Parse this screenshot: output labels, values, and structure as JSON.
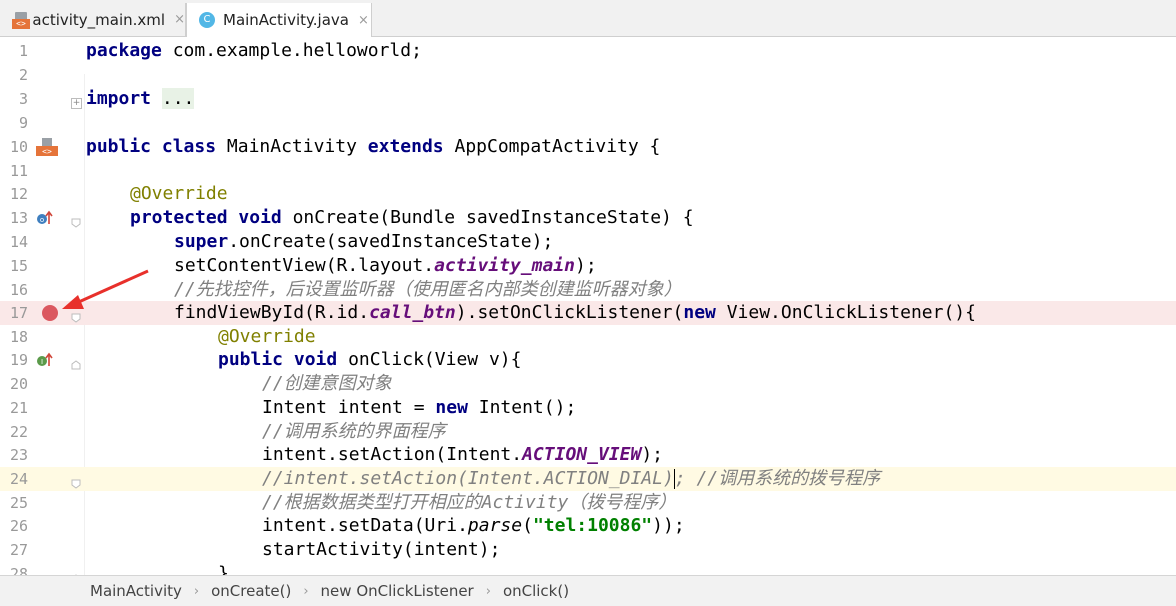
{
  "tabs": [
    {
      "label": "activity_main.xml",
      "icon": "xml-layout-icon",
      "close": "×",
      "active": false
    },
    {
      "label": "MainActivity.java",
      "icon": "java-class-icon",
      "icon_letter": "C",
      "close": "×",
      "active": true
    }
  ],
  "editor": {
    "lines": [
      {
        "n": "1"
      },
      {
        "n": "2"
      },
      {
        "n": "3"
      },
      {
        "n": "9"
      },
      {
        "n": "10"
      },
      {
        "n": "11"
      },
      {
        "n": "12"
      },
      {
        "n": "13"
      },
      {
        "n": "14"
      },
      {
        "n": "15"
      },
      {
        "n": "16"
      },
      {
        "n": "17"
      },
      {
        "n": "18"
      },
      {
        "n": "19"
      },
      {
        "n": "20"
      },
      {
        "n": "21"
      },
      {
        "n": "22"
      },
      {
        "n": "23"
      },
      {
        "n": "24"
      },
      {
        "n": "25"
      },
      {
        "n": "26"
      },
      {
        "n": "27"
      },
      {
        "n": "28"
      }
    ],
    "code": {
      "l1_kw": "package",
      "l1_rest": " com.example.helloworld;",
      "l3_kw": "import",
      "l3_collapsed": "...",
      "l9_kw1": "public",
      "l9_kw2": "class",
      "l9_name": " MainActivity ",
      "l9_kw3": "extends",
      "l9_rest": " AppCompatActivity {",
      "l12_ann": "@Override",
      "l13_kw1": "protected",
      "l13_kw2": "void",
      "l13_rest": " onCreate(Bundle savedInstanceState) {",
      "l14_kw": "super",
      "l14_rest": ".onCreate(savedInstanceState);",
      "l15_a": "setContentView(R.layout.",
      "l15_fld": "activity_main",
      "l15_b": ");",
      "l16_cmt": "//先找控件，后设置监听器（使用匿名内部类创建监听器对象）",
      "l17_a": "findViewById(R.id.",
      "l17_fld": "call_btn",
      "l17_b": ").setOnClickListener(",
      "l17_kw": "new",
      "l17_c": " View.OnClickListener(){",
      "l18_ann": "@Override",
      "l19_kw1": "public",
      "l19_kw2": "void",
      "l19_rest": " onClick(View v){",
      "l20_cmt": "//创建意图对象",
      "l21_a": "Intent intent = ",
      "l21_kw": "new",
      "l21_b": " Intent();",
      "l22_cmt": "//调用系统的界面程序",
      "l23_a": "intent.setAction(Intent.",
      "l23_fld": "ACTION_VIEW",
      "l23_b": ");",
      "l24_cmt1": "//intent.setAction(Intent.ACTION_DIAL)",
      "l24_cmt2": "; //调用系统的拨号程序",
      "l25_cmt": "//根据数据类型打开相应的Activity（拨号程序）",
      "l26_a": "intent.setData(Uri.",
      "l26_stat": "parse",
      "l26_b": "(",
      "l26_str": "\"tel:10086\"",
      "l26_c": "));",
      "l27_a": "startActivity(intent);",
      "l28_a": "}"
    }
  },
  "breadcrumbs": [
    "MainActivity",
    "onCreate()",
    "new OnClickListener",
    "onClick()"
  ],
  "breadcrumb_separator": "›",
  "colors": {
    "keyword": "#000080",
    "annotation": "#808000",
    "field": "#660e7a",
    "comment": "#808080",
    "string": "#008000",
    "breakpoint": "#db5860",
    "arrow": "#e8302b"
  }
}
